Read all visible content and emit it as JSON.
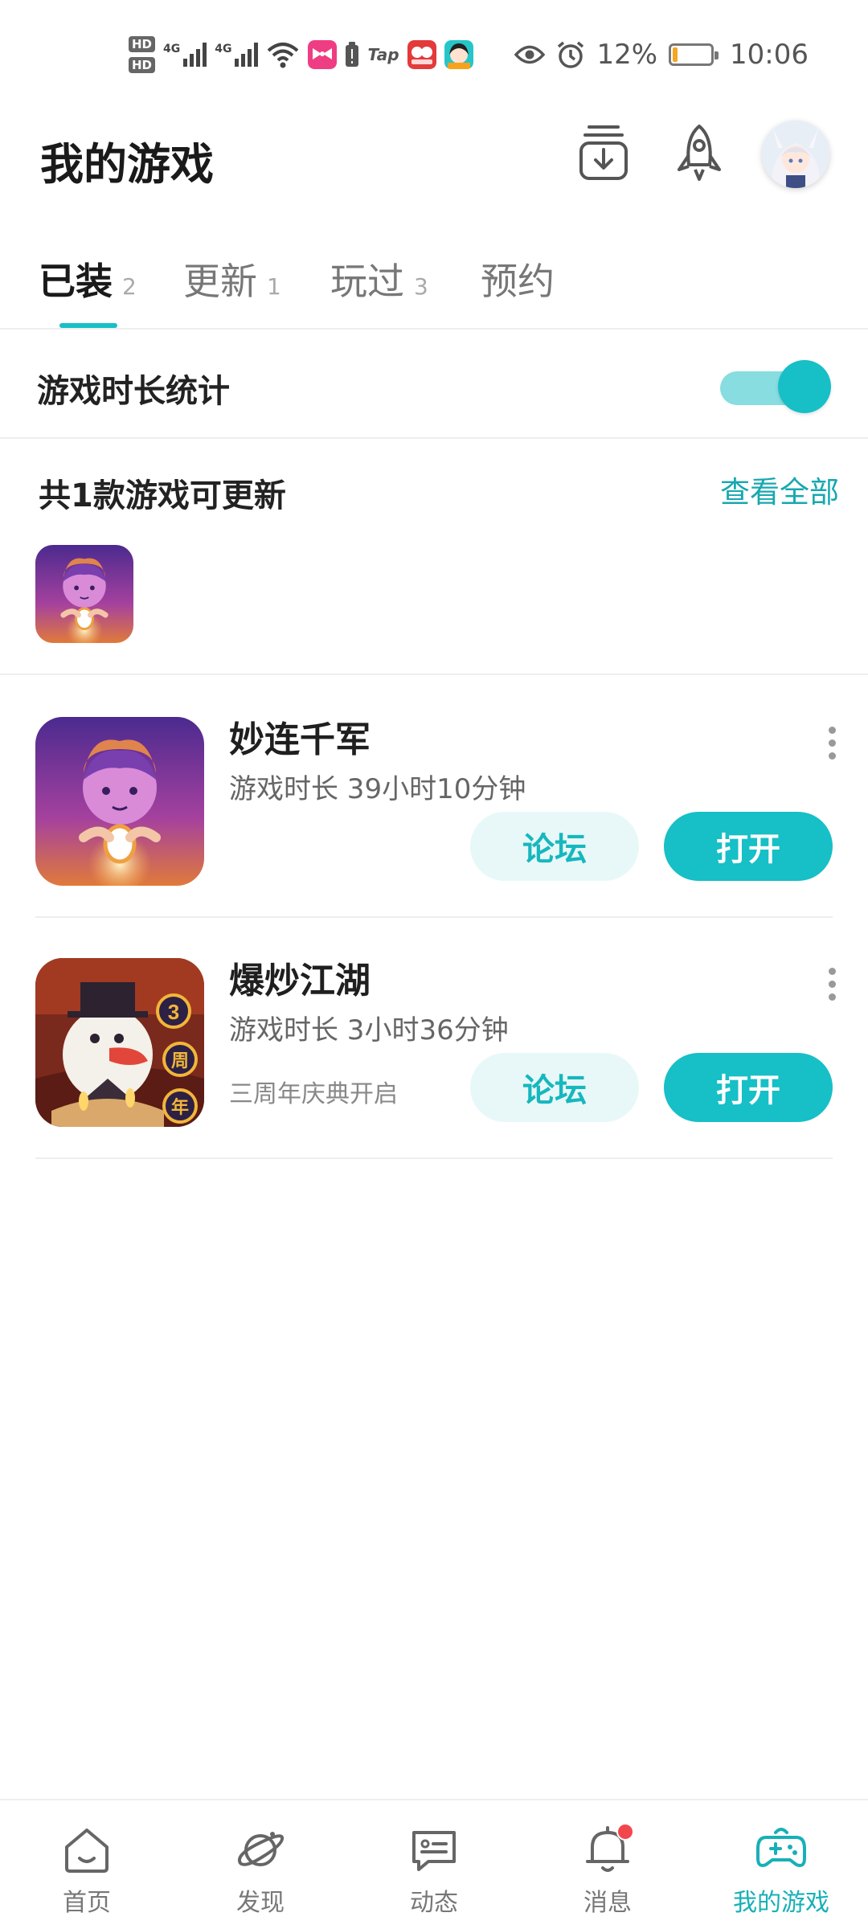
{
  "status_bar": {
    "hd1": "HD",
    "hd2": "HD",
    "net1": "4G",
    "net2": "4G",
    "tap": "Tap",
    "battery_percent": "12%",
    "battery_level": 0.12,
    "time": "10:06",
    "icons": [
      "eye-icon",
      "alarm-icon",
      "wifi-icon",
      "battery-icon"
    ]
  },
  "header": {
    "title": "我的游戏",
    "icons": [
      "download-icon",
      "rocket-icon",
      "avatar"
    ]
  },
  "tabs": [
    {
      "label": "已装",
      "count": "2",
      "active": true
    },
    {
      "label": "更新",
      "count": "1",
      "active": false
    },
    {
      "label": "玩过",
      "count": "3",
      "active": false
    },
    {
      "label": "预约",
      "count": "",
      "active": false
    }
  ],
  "stats": {
    "label": "游戏时长统计",
    "enabled": true
  },
  "updates": {
    "title": "共1款游戏可更新",
    "view_all": "查看全部"
  },
  "games": [
    {
      "name": "妙连千军",
      "playtime": "游戏时长 39小时10分钟",
      "subtitle": "",
      "forum_label": "论坛",
      "open_label": "打开"
    },
    {
      "name": "爆炒江湖",
      "playtime": "游戏时长 3小时36分钟",
      "subtitle": "三周年庆典开启",
      "icon_badge_num": "3",
      "icon_badge_a": "周",
      "icon_badge_b": "年",
      "forum_label": "论坛",
      "open_label": "打开"
    }
  ],
  "bottom_nav": [
    {
      "label": "首页",
      "icon": "home-icon",
      "active": false
    },
    {
      "label": "发现",
      "icon": "planet-icon",
      "active": false
    },
    {
      "label": "动态",
      "icon": "message-card-icon",
      "active": false
    },
    {
      "label": "消息",
      "icon": "bell-icon",
      "active": false,
      "badge": true
    },
    {
      "label": "我的游戏",
      "icon": "gamepad-icon",
      "active": true
    }
  ],
  "colors": {
    "accent": "#17bfc6",
    "accent_light": "#e8f8f8",
    "badge_red": "#f2474d",
    "battery": "#f5a623"
  }
}
